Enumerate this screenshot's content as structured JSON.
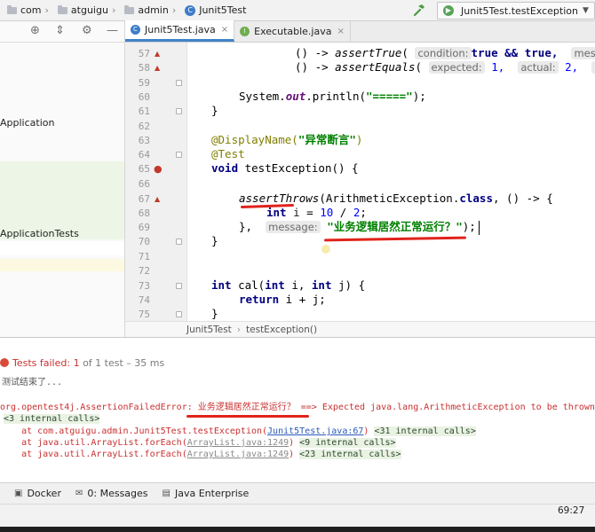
{
  "navbar": {
    "breadcrumbs": [
      "com",
      "atguigu",
      "admin",
      "Junit5Test"
    ],
    "run_config": "Junit5Test.testException"
  },
  "project": {
    "items": [
      "Application",
      "ApplicationTests"
    ]
  },
  "editor": {
    "tabs": [
      {
        "label": "Junit5Test.java",
        "active": true
      },
      {
        "label": "Executable.java",
        "active": false
      }
    ],
    "line_numbers": [
      "57",
      "58",
      "59",
      "60",
      "61",
      "62",
      "63",
      "64",
      "65",
      "66",
      "67",
      "68",
      "69",
      "70",
      "71",
      "72",
      "73",
      "74",
      "75"
    ],
    "code": {
      "l57_pre": "() -> ",
      "l57_method": "assertTrue",
      "l57_hint": "condition:",
      "l57_arg": "true && true,",
      "l57_hint2": "messa",
      "l58_pre": "() -> ",
      "l58_method": "assertEquals",
      "l58_hint1": "expected:",
      "l58_arg1": "1,",
      "l58_hint2": "actual:",
      "l58_arg2": "2,",
      "l58_hint3": "messa",
      "l60_a": "System.",
      "l60_field": "out",
      "l60_b": ".println(",
      "l60_str": "\"=====\"",
      "l60_c": ");",
      "l61": "}",
      "l63_ann": "@DisplayName(",
      "l63_str": "\"异常断言\"",
      "l63_ann_close": ")",
      "l64_ann": "@Test",
      "l65_kw": "void",
      "l65_rest": " testException() {",
      "l67_method": "assertThrows",
      "l67_rest": "(ArithmeticException.",
      "l67_kw": "class",
      "l67_rest2": ", () -> {",
      "l68_kw": "int",
      "l68_var": " i",
      "l68_eq": " = ",
      "l68_num1": "10",
      "l68_div": " / ",
      "l68_num2": "2",
      "l68_semi": ";",
      "l69_a": "},",
      "l69_hint": "message:",
      "l69_str": "\"业务逻辑居然正常运行？\"",
      "l69_close": ");",
      "l70": "}",
      "l73_kw1": "int",
      "l73_a": " cal(",
      "l73_kw2": "int",
      "l73_b": " i, ",
      "l73_kw3": "int",
      "l73_c": " j) {",
      "l74_kw": "return",
      "l74_rest": " i + j;",
      "l75": "}"
    },
    "breadcrumb": [
      "Junit5Test",
      "testException()"
    ]
  },
  "run": {
    "status_label": "Tests failed:",
    "failed_count": "1",
    "status_tail": "of 1 test – 35 ms",
    "console": {
      "line0": "测试结束了...",
      "line1_err": "org.opentest4j.AssertionFailedError: 业务逻辑居然正常运行？ ==> Expected java.lang.ArithmeticException to be thrown",
      "line2": "<3 internal calls>",
      "line3_a": "    at com.atguigu.admin.Junit5Test.testException(",
      "line3_link": "Junit5Test.java:67",
      "line3_b": ") ",
      "line3_calls": "<31 internal calls>",
      "line4_a": "    at java.util.ArrayList.forEach(",
      "line4_link": "ArrayList.java:1249",
      "line4_b": ") ",
      "line4_calls": "<9 internal calls>",
      "line5_a": "    at java.util.ArrayList.forEach(",
      "line5_link": "ArrayList.java:1249",
      "line5_b": ") ",
      "line5_calls": "<23 internal calls>"
    }
  },
  "tool_tabs": [
    "Docker",
    "0: Messages",
    "Java Enterprise"
  ],
  "status": {
    "cursor": "69:27"
  },
  "colors": {
    "accent": "#4083c9",
    "error": "#c93030",
    "annotation_red": "#e0231b"
  }
}
